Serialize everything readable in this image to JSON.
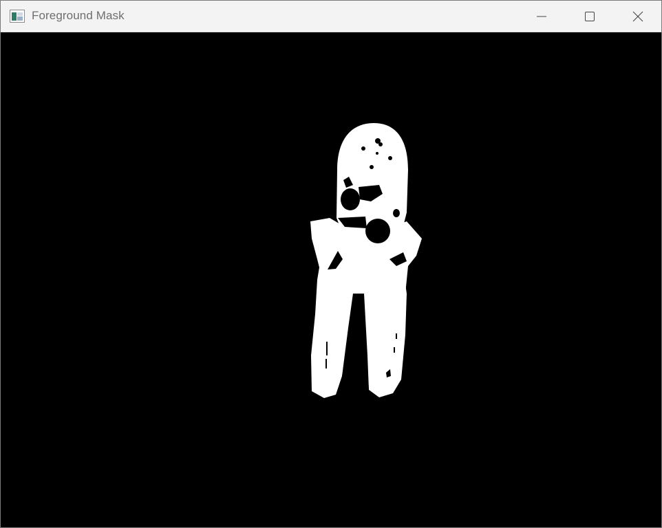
{
  "window": {
    "title": "Foreground Mask",
    "app_icon": "opencv-window-icon"
  },
  "controls": {
    "minimize_icon": "minimize-icon",
    "maximize_icon": "maximize-icon",
    "close_icon": "close-icon"
  },
  "canvas": {
    "description_icon": "binary-mask-image",
    "background_color": "#000000",
    "foreground_color": "#ffffff"
  }
}
